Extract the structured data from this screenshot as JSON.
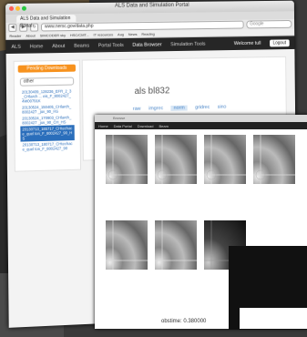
{
  "window": {
    "title": "ALS Data and Simulation Portal"
  },
  "tab": {
    "label": "ALS Data and Simulation Portal"
  },
  "toolbar": {
    "url": "www.nersc.gov/data.php",
    "search_placeholder": "Google"
  },
  "bookmarks": [
    "Reader",
    "About",
    "SIMCODER sky",
    "HSC/CMT...",
    "IT resources",
    "Aug",
    "News",
    "Reading",
    "ShiftZ",
    "ADP"
  ],
  "nav": {
    "items": [
      "ALS",
      "Home",
      "About",
      "Beams",
      "Portal Tools",
      "Data Browser",
      "Simulation Tools"
    ],
    "active_index": 5,
    "welcome": "Welcome tull",
    "logout": "Logout"
  },
  "sidebar": {
    "pending_label": "Pending Downloads",
    "filter_value": "other",
    "items": [
      "20130409_128236_EFR_2_3_CHlarch ... eis_F_8002427_4W00791K",
      "20130524_150405_CHlarch_8002427 _juv_90_HS",
      "20130524_170903_CHlarch_8002427 _juv_90_CH_HS",
      "20130713_165717_CHtechace_quel ton_F_8002427_90_HS",
      "20130713_180717_CHtechace_quel ton_F_8002427_90"
    ],
    "selected_index": 3
  },
  "dataset": {
    "title": "als bl832",
    "formats": [
      "raw",
      "imgrec",
      "norm",
      "gridrec",
      "sino"
    ],
    "active_format": 2
  },
  "viewer": {
    "title_text": "Browse",
    "menu": [
      "Home",
      "Data Portal",
      "Download",
      "Beam"
    ],
    "obstime_label": "obstime: 0.380000"
  },
  "colors": {
    "accent": "#f7921e",
    "link": "#2a6ebb",
    "nav_bg": "#262626"
  }
}
